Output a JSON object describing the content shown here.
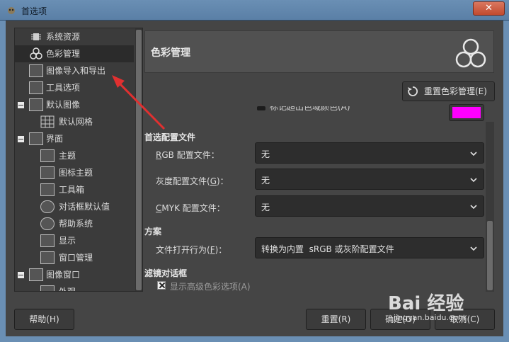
{
  "window": {
    "title": "首选项",
    "close_label": "✕"
  },
  "tree": {
    "items": [
      {
        "label": "系统资源",
        "icon": "chip-icon"
      },
      {
        "label": "色彩管理",
        "icon": "color-circles-icon",
        "selected": true
      },
      {
        "label": "图像导入和导出",
        "icon": "image-import-icon"
      },
      {
        "label": "工具选项",
        "icon": "tool-options-icon"
      },
      {
        "label": "默认图像",
        "icon": "default-image-icon",
        "expanded": true
      },
      {
        "label": "默认网格",
        "icon": "grid-icon"
      },
      {
        "label": "界面",
        "icon": "interface-icon",
        "expanded": true
      },
      {
        "label": "主题",
        "icon": "theme-icon"
      },
      {
        "label": "图标主题",
        "icon": "icon-theme-icon"
      },
      {
        "label": "工具箱",
        "icon": "toolbox-icon"
      },
      {
        "label": "对话框默认值",
        "icon": "dialog-defaults-icon"
      },
      {
        "label": "帮助系统",
        "icon": "help-system-icon"
      },
      {
        "label": "显示",
        "icon": "display-icon"
      },
      {
        "label": "窗口管理",
        "icon": "window-management-icon"
      },
      {
        "label": "图像窗口",
        "icon": "image-window-icon",
        "expanded": true
      },
      {
        "label": "外观",
        "icon": "appearance-icon"
      }
    ]
  },
  "panel": {
    "title": "色彩管理",
    "reset_button": "重置色彩管理(E)",
    "partial_option": "标记超出色域颜色(A)",
    "preferred_profiles": {
      "section": "首选配置文件",
      "rows": [
        {
          "label_pre": "",
          "label_accel": "R",
          "label_post": "GB 配置文件：",
          "value": "无"
        },
        {
          "label_pre": "灰度配置文件(",
          "label_accel": "G",
          "label_post": ")：",
          "value": "无"
        },
        {
          "label_pre": "",
          "label_accel": "C",
          "label_post": "MYK 配置文件：",
          "value": "无"
        }
      ]
    },
    "policy": {
      "section": "方案",
      "label_pre": "文件打开行为(",
      "label_accel": "F",
      "label_post": ")：",
      "value": "转换为内置  sRGB 或灰阶配置文件"
    },
    "filter_dialogs": {
      "section": "滤镜对话框",
      "checkbox_label": "显示高级色彩选项(A)",
      "checked": true
    }
  },
  "buttons": {
    "help": "帮助(H)",
    "reset": "重置(R)",
    "ok": "确定(O)",
    "cancel": "取消(C)"
  },
  "watermark": {
    "brand": "Bai 经验",
    "url": "jingyan.baidu.com"
  },
  "colors": {
    "accent_magenta": "#ff00ff",
    "annotation_arrow": "#e03030"
  }
}
